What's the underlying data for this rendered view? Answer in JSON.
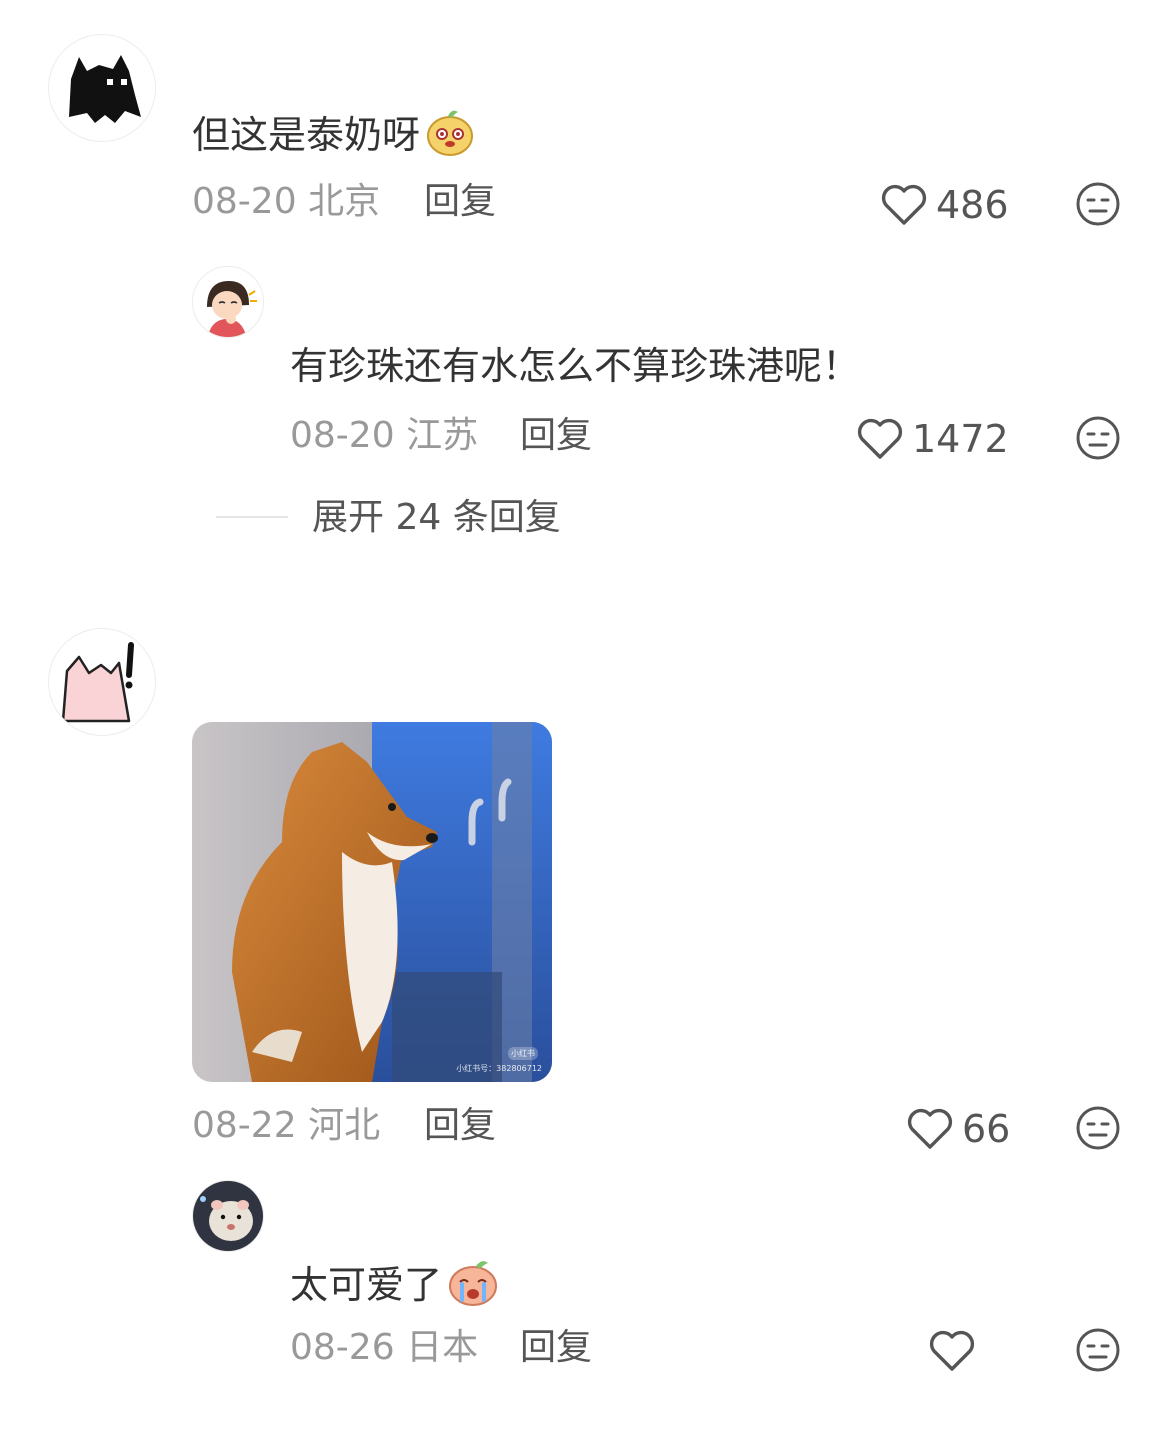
{
  "comments": [
    {
      "user": "",
      "text": "但这是泰奶呀",
      "date": "08-20",
      "location": "北京",
      "reply_label": "回复",
      "likes": "486",
      "avatar_icon": "black-cat-icon",
      "emoji_icon": "melon-emoji-icon",
      "replies": [
        {
          "user": "",
          "text": "有珍珠还有水怎么不算珍珠港呢！",
          "date": "08-20",
          "location": "江苏",
          "reply_label": "回复",
          "likes": "1472",
          "avatar_icon": "thinking-girl-icon"
        }
      ],
      "expand_label": "展开 24 条回复"
    },
    {
      "user": "",
      "date": "08-22",
      "location": "河北",
      "reply_label": "回复",
      "likes": "66",
      "avatar_icon": "pink-cat-icon",
      "image": {
        "description_icon": "shiba-dog-photo",
        "watermark": "小红书号：382806712",
        "watermark_logo": "小红书"
      },
      "replies": [
        {
          "user": "",
          "text": "太可爱了",
          "date": "08-26",
          "location": "日本",
          "reply_label": "回复",
          "likes": "",
          "avatar_icon": "hamster-icon",
          "emoji_icon": "crying-melon-emoji-icon"
        }
      ]
    }
  ],
  "colors": {
    "text": "#333333",
    "meta": "#999999",
    "icon": "#555555",
    "divider": "#e6e6e6"
  }
}
